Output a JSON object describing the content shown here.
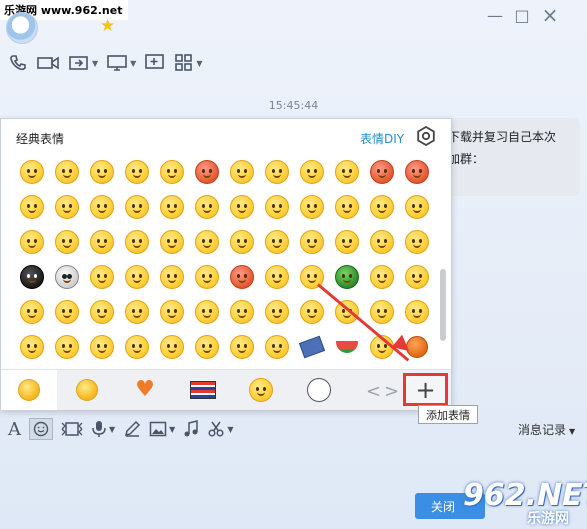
{
  "watermark_top": "乐游网 www.962.net",
  "header": {
    "min_label": "—",
    "max_label": "□",
    "close_label": "×"
  },
  "chat": {
    "time": "15:45:44",
    "message_lines": [
      "下载并复习自己本次",
      "加群："
    ]
  },
  "emoji_panel": {
    "title": "经典表情",
    "diy_label": "表情DIY",
    "add_label": "+",
    "tooltip": "添加表情",
    "prev_label": "<",
    "next_label": ">",
    "tabs": [
      "classic-face",
      "emoji-face",
      "heart",
      "flag",
      "character",
      "panda"
    ]
  },
  "input_toolbar": {
    "history_label": "消息记录"
  },
  "footer": {
    "close_label": "关闭"
  },
  "watermark_br": {
    "big": "962.NET",
    "small": "乐游网"
  },
  "colors": {
    "accent": "#3a8ee6",
    "highlight": "#e53935",
    "diy_link": "#1f8fd2"
  }
}
